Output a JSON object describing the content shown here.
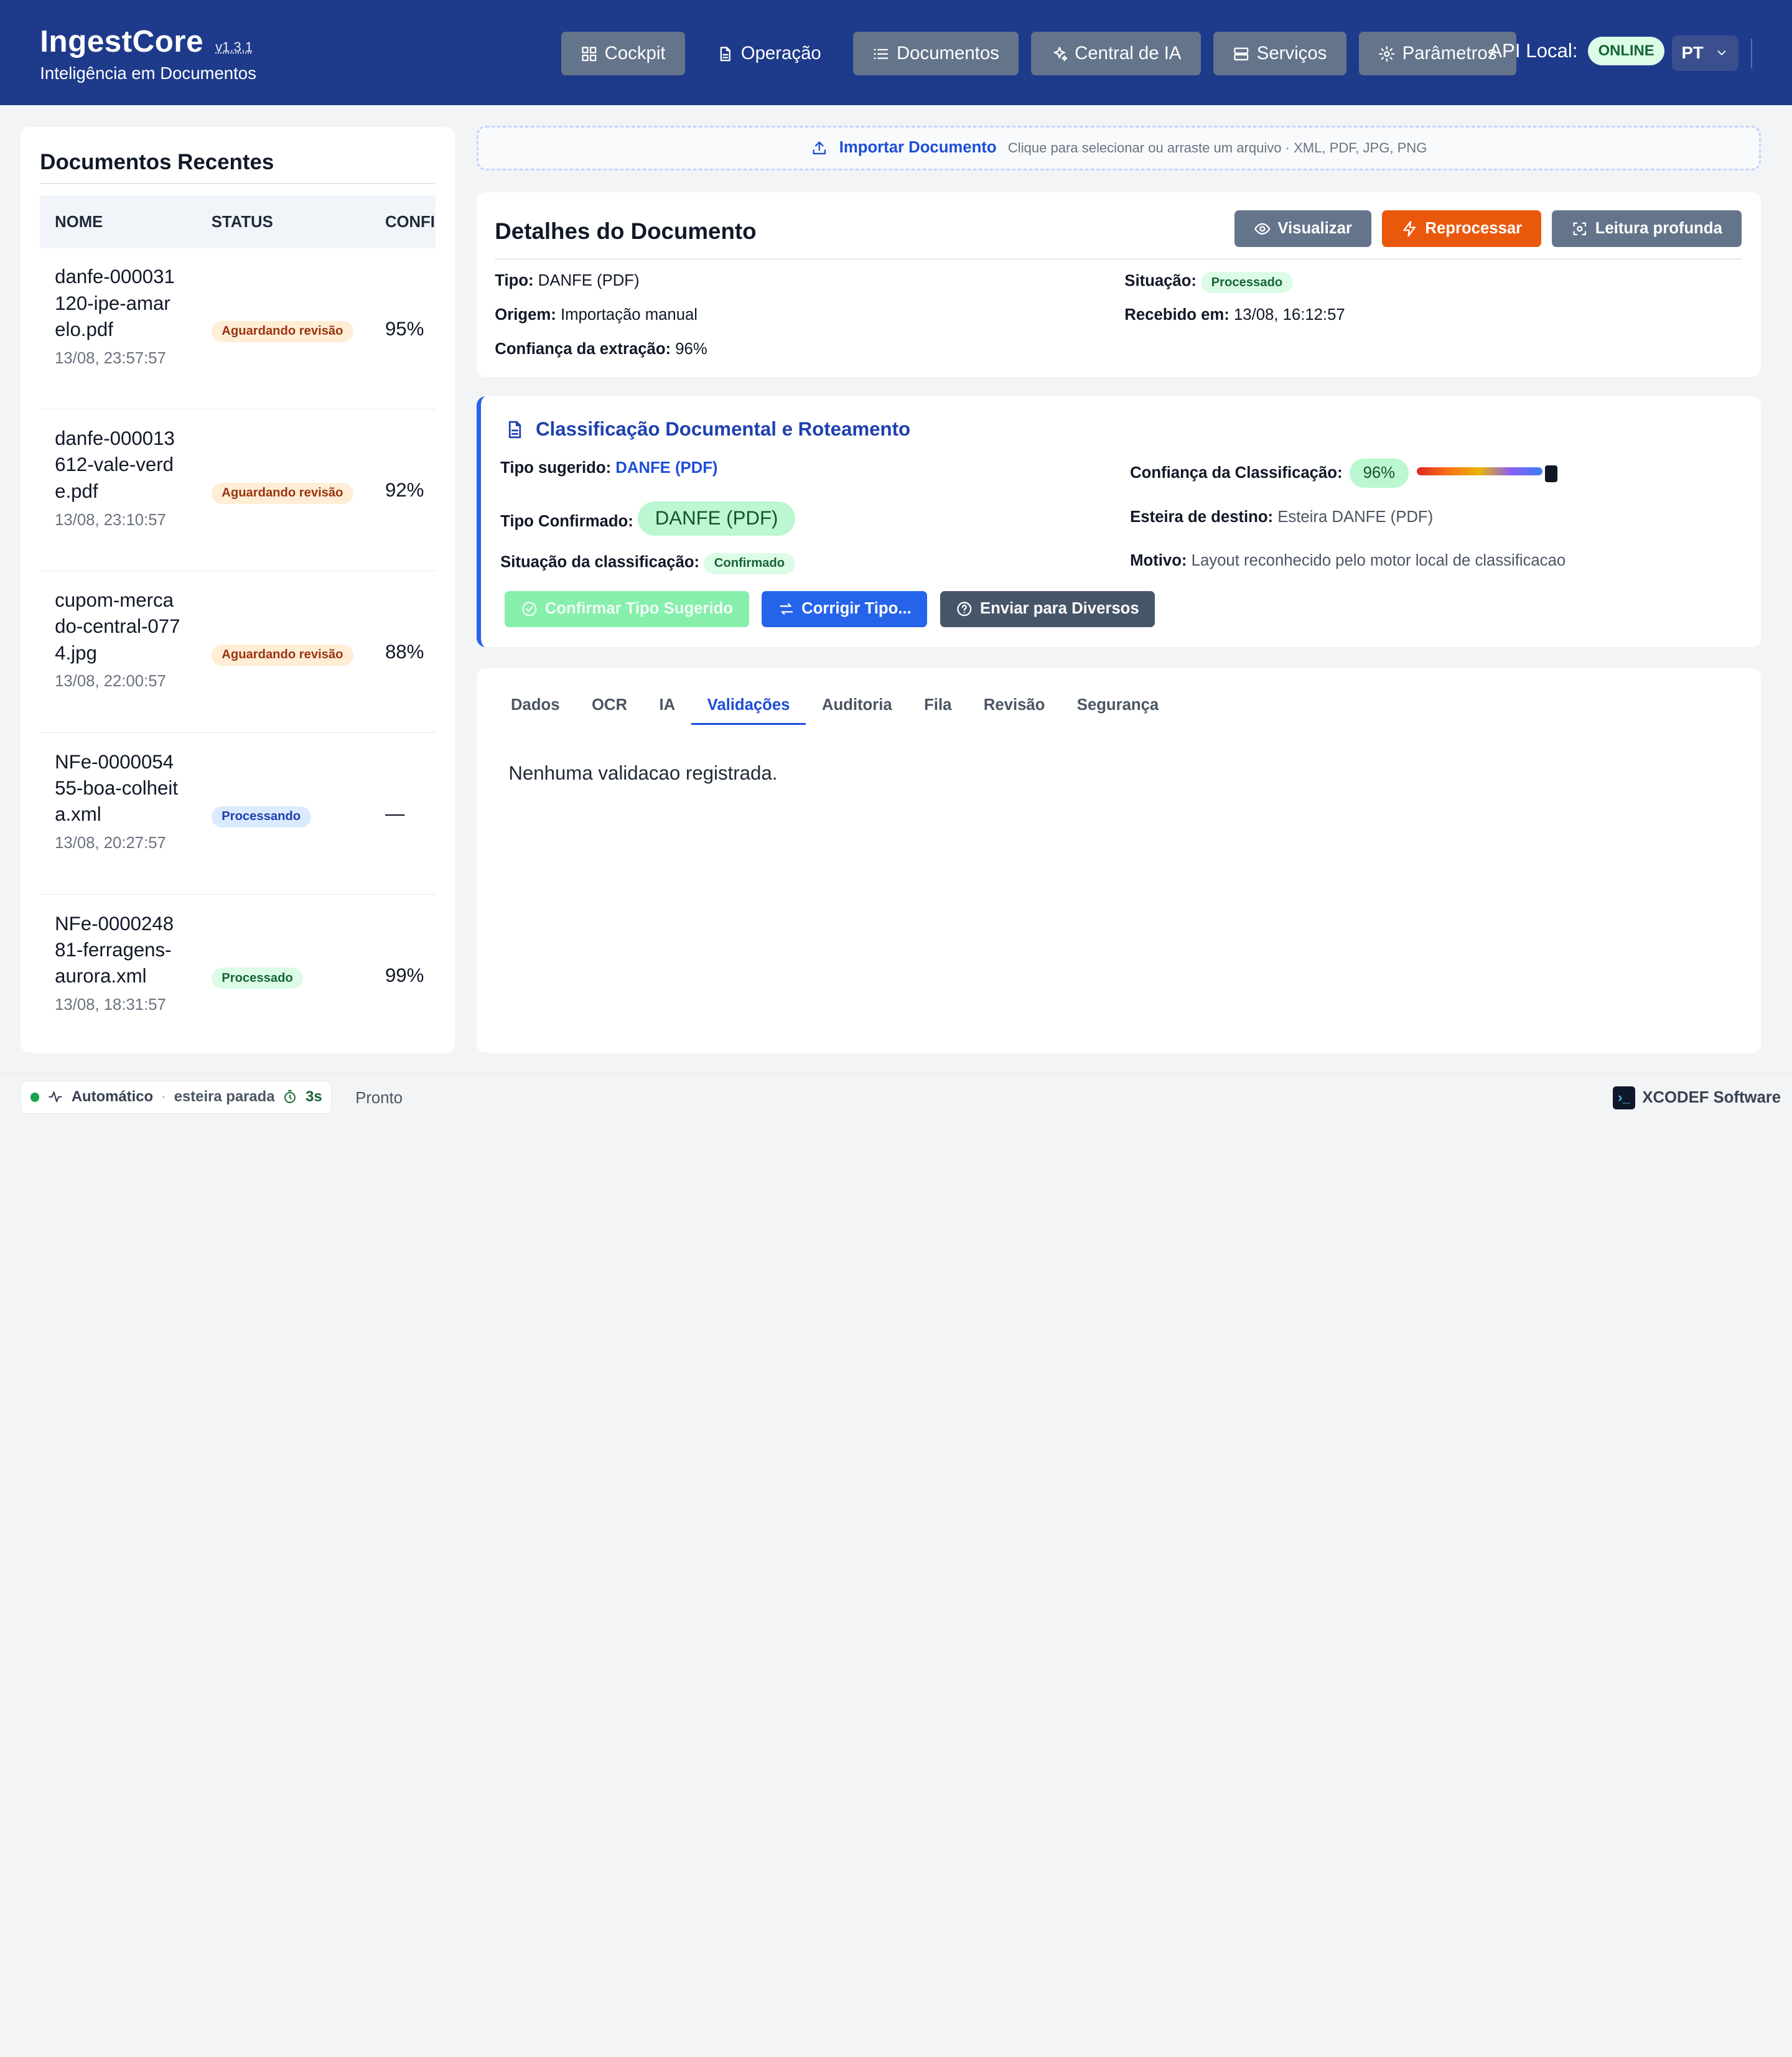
{
  "header": {
    "title": "IngestCore",
    "version": "v1.3.1",
    "subtitle": "Inteligência em Documentos",
    "nav": [
      {
        "label": "Cockpit",
        "icon": "dashboard-icon"
      },
      {
        "label": "Operação",
        "icon": "document-icon"
      },
      {
        "label": "Documentos",
        "icon": "list-icon"
      },
      {
        "label": "Central de IA",
        "icon": "sparkles-icon"
      },
      {
        "label": "Serviços",
        "icon": "server-icon"
      },
      {
        "label": "Parâmetros",
        "icon": "gear-icon"
      }
    ],
    "api_label": "API Local:",
    "api_status": "ONLINE",
    "language": "PT"
  },
  "sidebar": {
    "title": "Documentos Recentes",
    "columns": [
      "NOME",
      "STATUS",
      "CONFI"
    ],
    "rows": [
      {
        "name": "danfe-000031120-ipe-amarelo.pdf",
        "date": "13/08, 23:57:57",
        "status": "Aguardando revisão",
        "status_kind": "warn",
        "confidence": "95%"
      },
      {
        "name": "danfe-000013612-vale-verde.pdf",
        "date": "13/08, 23:10:57",
        "status": "Aguardando revisão",
        "status_kind": "warn",
        "confidence": "92%"
      },
      {
        "name": "cupom-mercado-central-0774.jpg",
        "date": "13/08, 22:00:57",
        "status": "Aguardando revisão",
        "status_kind": "warn",
        "confidence": "88%"
      },
      {
        "name": "NFe-000005455-boa-colheita.xml",
        "date": "13/08, 20:27:57",
        "status": "Processando",
        "status_kind": "info",
        "confidence": "—"
      },
      {
        "name": "NFe-000024881-ferragens-aurora.xml",
        "date": "13/08, 18:31:57",
        "status": "Processado",
        "status_kind": "ok",
        "confidence": "99%"
      }
    ]
  },
  "upload": {
    "label": "Importar Documento",
    "hint": "Clique para selecionar ou arraste um arquivo · XML, PDF, JPG, PNG"
  },
  "details": {
    "title": "Detalhes do Documento",
    "actions": {
      "view": "Visualizar",
      "reprocess": "Reprocessar",
      "deep_read": "Leitura profunda"
    },
    "type_label": "Tipo:",
    "type_value": "DANFE (PDF)",
    "origin_label": "Origem:",
    "origin_value": "Importação manual",
    "confidence_label": "Confiança da extração:",
    "confidence_value": "96%",
    "situation_label": "Situação:",
    "situation_value": "Processado",
    "received_label": "Recebido em:",
    "received_value": "13/08, 16:12:57"
  },
  "classification": {
    "title": "Classificação Documental e Roteamento",
    "suggested_label": "Tipo sugerido:",
    "suggested_value": "DANFE (PDF)",
    "confirmed_label": "Tipo Confirmado:",
    "confirmed_value": "DANFE (PDF)",
    "situation_label": "Situação da classificação:",
    "situation_value": "Confirmado",
    "confidence_label": "Confiança da Classificação:",
    "confidence_value": "96%",
    "confidence_fraction": 0.96,
    "destination_label": "Esteira de destino:",
    "destination_value": "Esteira DANFE (PDF)",
    "reason_label": "Motivo:",
    "reason_value": "Layout reconhecido pelo motor local de classificacao",
    "buttons": {
      "confirm": "Confirmar Tipo Sugerido",
      "correct": "Corrigir Tipo...",
      "send": "Enviar para Diversos"
    }
  },
  "tabs": {
    "items": [
      "Dados",
      "OCR",
      "IA",
      "Validações",
      "Auditoria",
      "Fila",
      "Revisão",
      "Segurança"
    ],
    "active": "Validações",
    "empty_message": "Nenhuma validacao registrada."
  },
  "footer": {
    "mode": "Automático",
    "pipeline": "esteira parada",
    "timer": "3s",
    "ready": "Pronto",
    "brand": "XCODEF Software"
  },
  "colors": {
    "header_bg": "#1e3a8a",
    "accent": "#1d4ed8",
    "orange": "#ea580c",
    "success": "#16a34a"
  }
}
